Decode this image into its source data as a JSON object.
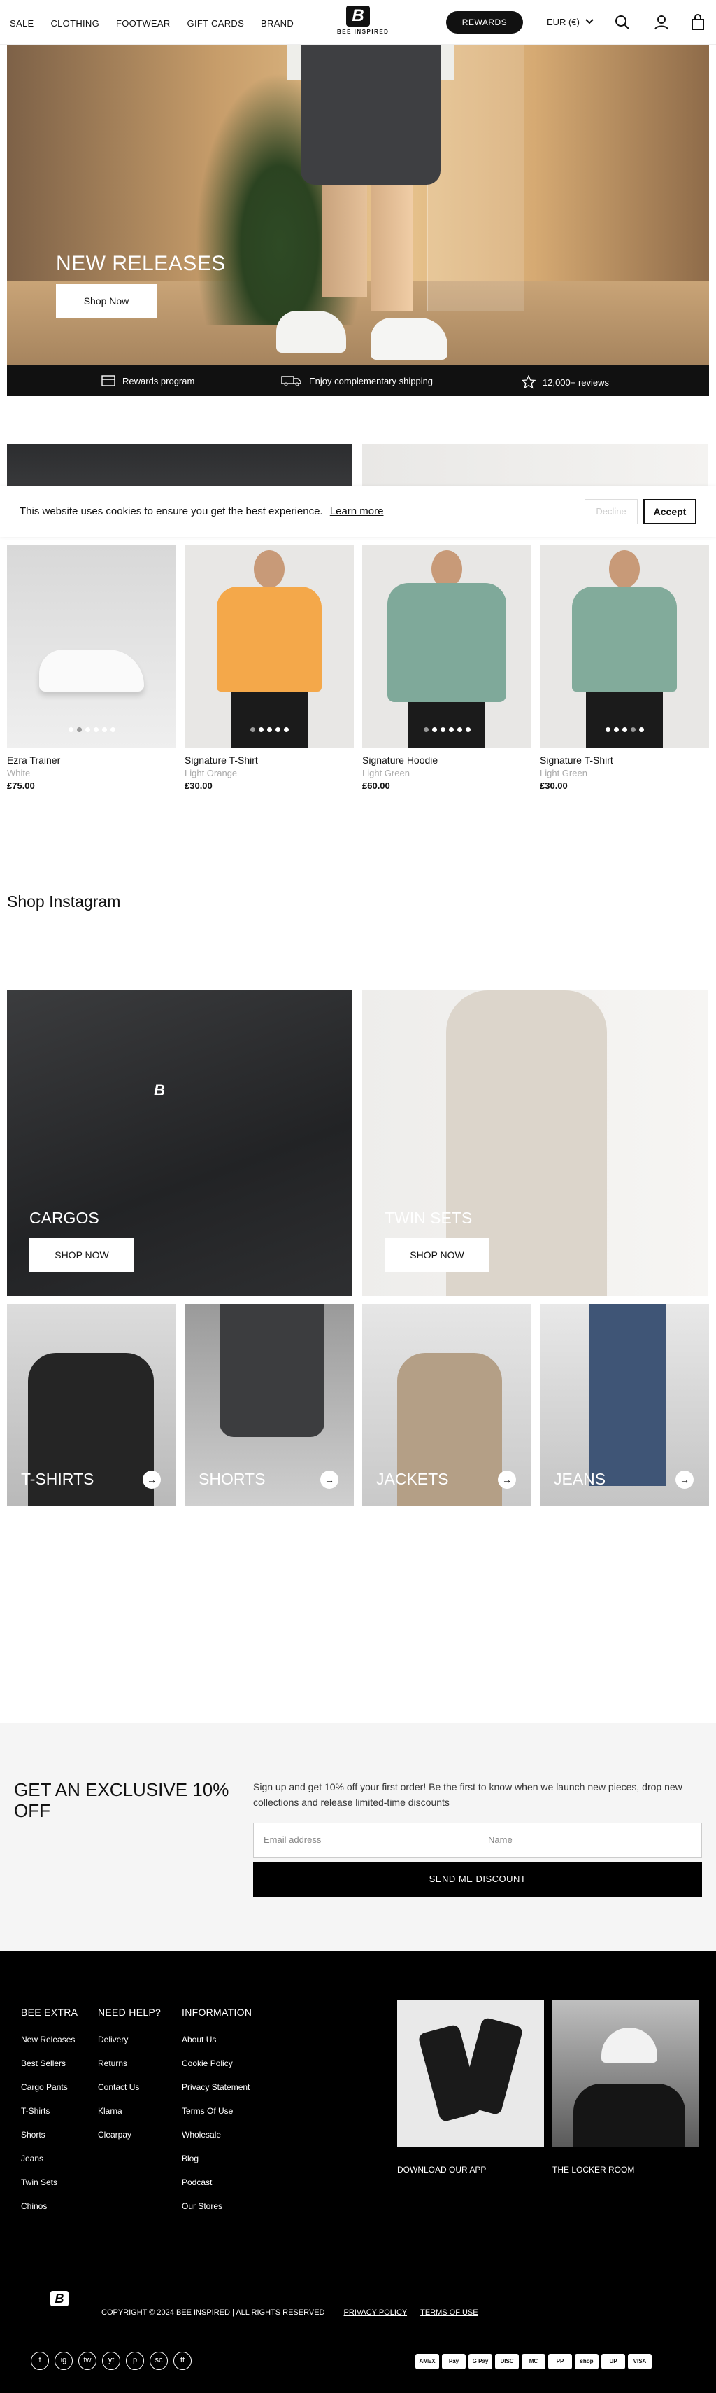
{
  "header": {
    "nav": [
      "SALE",
      "CLOTHING",
      "FOOTWEAR",
      "GIFT CARDS",
      "BRAND"
    ],
    "logo_letter": "B",
    "logo_text": "BEE INSPIRED",
    "rewards": "REWARDS",
    "currency": "EUR (€)"
  },
  "hero": {
    "title": "NEW RELEASES",
    "button": "Shop Now"
  },
  "strip": {
    "rewards": "Rewards program",
    "shipping": "Enjoy complementary shipping",
    "reviews": "12,000+ reviews"
  },
  "cookie": {
    "message": "This website uses cookies to ensure you get the best experience.",
    "learn_more": "Learn more",
    "decline": "Decline",
    "accept": "Accept"
  },
  "products": [
    {
      "name": "Ezra Trainer",
      "color": "White",
      "price": "£75.00"
    },
    {
      "name": "Signature T-Shirt",
      "color": "Light Orange",
      "price": "£30.00"
    },
    {
      "name": "Signature Hoodie",
      "color": "Light Green",
      "price": "£60.00"
    },
    {
      "name": "Signature T-Shirt",
      "color": "Light Green",
      "price": "£30.00"
    }
  ],
  "instagram_heading": "Shop Instagram",
  "collections": [
    {
      "title": "CARGOS",
      "button": "SHOP NOW"
    },
    {
      "title": "TWIN SETS",
      "button": "SHOP NOW"
    }
  ],
  "categories": [
    "T-SHIRTS",
    "SHORTS",
    "JACKETS",
    "JEANS"
  ],
  "newsletter": {
    "heading": "GET AN EXCLUSIVE 10% OFF",
    "text": "Sign up and get 10% off your first order! Be the first to know when we launch new pieces, drop new collections and release limited-time discounts",
    "email_placeholder": "Email address",
    "name_placeholder": "Name",
    "button": "SEND ME DISCOUNT"
  },
  "footer": {
    "col1": {
      "heading": "BEE EXTRA",
      "links": [
        "New Releases",
        "Best Sellers",
        "Cargo Pants",
        "T-Shirts",
        "Shorts",
        "Jeans",
        "Twin Sets",
        "Chinos"
      ]
    },
    "col2": {
      "heading": "NEED HELP?",
      "links": [
        "Delivery",
        "Returns",
        "Contact Us",
        "Klarna",
        "Clearpay"
      ]
    },
    "col3": {
      "heading": "INFORMATION",
      "links": [
        "About Us",
        "Cookie Policy",
        "Privacy Statement",
        "Terms Of Use",
        "Wholesale",
        "Blog",
        "Podcast",
        "Our Stores"
      ]
    },
    "app_label": "DOWNLOAD OUR APP",
    "locker_label": "THE LOCKER ROOM",
    "copyright": "COPYRIGHT © 2024 BEE INSPIRED | ALL RIGHTS RESERVED",
    "privacy": "PRIVACY POLICY",
    "terms": "TERMS OF USE",
    "social": [
      "f",
      "ig",
      "tw",
      "yt",
      "p",
      "sc",
      "tt"
    ],
    "payments": [
      "AMEX",
      "Pay",
      "G Pay",
      "DISC",
      "MC",
      "PP",
      "shop",
      "UP",
      "VISA"
    ]
  }
}
